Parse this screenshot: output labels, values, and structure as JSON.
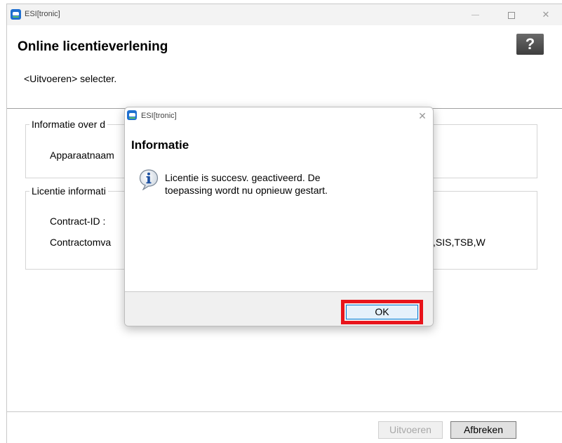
{
  "window": {
    "title": "ESI[tronic]",
    "controls": {
      "minimize": "—",
      "maximize": "",
      "close": "✕"
    }
  },
  "header": {
    "title": "Online licentieverlening",
    "help_label": "?"
  },
  "instruction": "<Uitvoeren> selecter.",
  "device_group": {
    "legend": "Informatie over d",
    "device_name_label": "Apparaatnaam"
  },
  "license_group": {
    "legend": "Licentie informati",
    "contract_id_label": "Contract-ID :",
    "contract_scope_label": "Contractomva",
    "contract_scope_value": ",SIS,TSB,W"
  },
  "footer": {
    "execute_label": "Uitvoeren",
    "cancel_label": "Afbreken"
  },
  "dialog": {
    "title": "ESI[tronic]",
    "close_label": "✕",
    "heading": "Informatie",
    "message_line1": "Licentie is succesv. geactiveerd. De",
    "message_line2": "toepassing wordt nu opnieuw gestart.",
    "ok_label": "OK",
    "icon": "info-icon"
  },
  "colors": {
    "highlight": "#e8141b",
    "accent": "#0078d4",
    "app_icon": "#1e6fd0"
  }
}
